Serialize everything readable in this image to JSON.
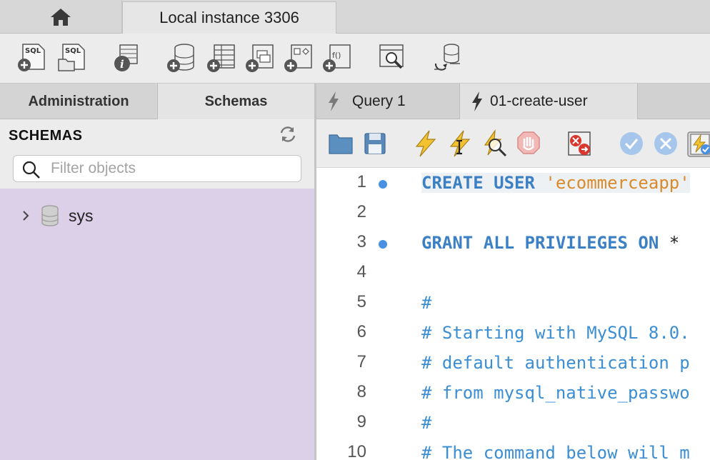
{
  "topbar": {
    "home_icon": "home-icon",
    "connection_tab": "Local instance 3306"
  },
  "toolbar": {
    "icons": [
      "new-sql-tab-icon",
      "open-sql-script-icon",
      "server-info-icon",
      "create-schema-icon",
      "create-table-icon",
      "create-view-icon",
      "create-procedure-icon",
      "create-function-icon",
      "search-table-data-icon",
      "reconnect-icon"
    ]
  },
  "sidebar": {
    "tabs": [
      {
        "label": "Administration"
      },
      {
        "label": "Schemas"
      }
    ],
    "title": "SCHEMAS",
    "filter_placeholder": "Filter objects",
    "tree": [
      {
        "label": "sys"
      }
    ],
    "tree_bg": "#dccfe8"
  },
  "editor": {
    "tabs": [
      {
        "label": "Query 1"
      },
      {
        "label": "01-create-user"
      }
    ],
    "toolbar_icons": [
      "open-file-icon",
      "save-icon",
      "execute-icon",
      "execute-current-icon",
      "explain-icon",
      "stop-icon",
      "toggle-error-icon",
      "commit-icon",
      "rollback-icon",
      "autocommit-icon"
    ],
    "lines": [
      {
        "num": "1",
        "dot": true,
        "tokens": [
          {
            "t": "CREATE USER ",
            "c": "kw"
          },
          {
            "t": "'ecommerceapp'",
            "c": "str"
          }
        ]
      },
      {
        "num": "2",
        "dot": false,
        "tokens": []
      },
      {
        "num": "3",
        "dot": true,
        "tokens": [
          {
            "t": "GRANT ALL PRIVILEGES ON ",
            "c": "kw"
          },
          {
            "t": "*",
            "c": "op"
          }
        ]
      },
      {
        "num": "4",
        "dot": false,
        "tokens": []
      },
      {
        "num": "5",
        "dot": false,
        "tokens": [
          {
            "t": "#",
            "c": "cm"
          }
        ]
      },
      {
        "num": "6",
        "dot": false,
        "tokens": [
          {
            "t": "# Starting with MySQL 8.0.",
            "c": "cm"
          }
        ]
      },
      {
        "num": "7",
        "dot": false,
        "tokens": [
          {
            "t": "# default authentication p",
            "c": "cm"
          }
        ]
      },
      {
        "num": "8",
        "dot": false,
        "tokens": [
          {
            "t": "# from mysql_native_passwo",
            "c": "cm"
          }
        ]
      },
      {
        "num": "9",
        "dot": false,
        "tokens": [
          {
            "t": "#",
            "c": "cm"
          }
        ]
      },
      {
        "num": "10",
        "dot": false,
        "tokens": [
          {
            "t": "# The command below will m",
            "c": "cm"
          }
        ]
      }
    ]
  },
  "colors": {
    "keyword": "#3b7fc4",
    "string": "#d98a2b",
    "comment": "#3b8ed4",
    "breakpoint_dot": "#4a90e2"
  }
}
